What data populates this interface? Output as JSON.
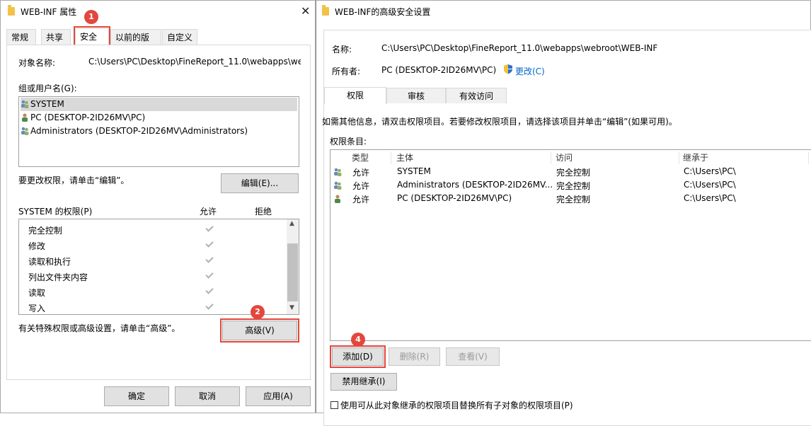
{
  "left_window": {
    "title": "WEB-INF 属性",
    "tabs": [
      "常规",
      "共享",
      "安全",
      "以前的版本",
      "自定义"
    ],
    "object_name_label": "对象名称:",
    "object_name_value": "C:\\Users\\PC\\Desktop\\FineReport_11.0\\webapps\\we",
    "groups_label": "组或用户名(G):",
    "users": [
      "SYSTEM",
      "PC (DESKTOP-2ID26MV\\PC)",
      "Administrators (DESKTOP-2ID26MV\\Administrators)"
    ],
    "change_hint": "要更改权限，请单击“编辑”。",
    "edit_button": "编辑(E)...",
    "perm_header": "SYSTEM 的权限(P)",
    "allow_header": "允许",
    "deny_header": "拒绝",
    "permissions": [
      "完全控制",
      "修改",
      "读取和执行",
      "列出文件夹内容",
      "读取",
      "写入"
    ],
    "special_hint": "有关特殊权限或高级设置，请单击“高级”。",
    "advanced_button": "高级(V)",
    "ok_button": "确定",
    "cancel_button": "取消",
    "apply_button": "应用(A)"
  },
  "right_window": {
    "title": "WEB-INF的高级安全设置",
    "name_label": "名称:",
    "name_value": "C:\\Users\\PC\\Desktop\\FineReport_11.0\\webapps\\webroot\\WEB-INF",
    "owner_label": "所有者:",
    "owner_value": "PC (DESKTOP-2ID26MV\\PC)",
    "change_link": "更改(C)",
    "tabs": [
      "权限",
      "审核",
      "有效访问"
    ],
    "info_text": "如需其他信息，请双击权限项目。若要修改权限项目，请选择该项目并单击“编辑”(如果可用)。",
    "entries_label": "权限条目:",
    "columns": [
      "类型",
      "主体",
      "访问",
      "继承于"
    ],
    "entries": [
      {
        "type": "允许",
        "principal": "SYSTEM",
        "access": "完全控制",
        "inherited": "C:\\Users\\PC\\"
      },
      {
        "type": "允许",
        "principal": "Administrators (DESKTOP-2ID26MV...",
        "access": "完全控制",
        "inherited": "C:\\Users\\PC\\"
      },
      {
        "type": "允许",
        "principal": "PC (DESKTOP-2ID26MV\\PC)",
        "access": "完全控制",
        "inherited": "C:\\Users\\PC\\"
      }
    ],
    "add_button": "添加(D)",
    "remove_button": "删除(R)",
    "view_button": "查看(V)",
    "disable_inherit_button": "禁用继承(I)",
    "replace_checkbox_label": "使用可从此对象继承的权限项目替换所有子对象的权限项目(P)"
  },
  "badges": [
    "1",
    "2",
    "4"
  ],
  "colors": {
    "highlight": "#e2473d",
    "link": "#0066cc"
  }
}
